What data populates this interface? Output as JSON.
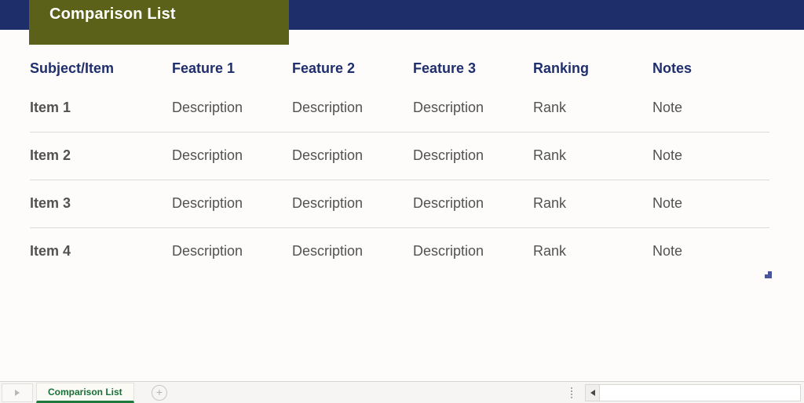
{
  "window": {
    "title": "Comparison List"
  },
  "table": {
    "headers": [
      "Subject/Item",
      "Feature 1",
      "Feature 2",
      "Feature 3",
      "Ranking",
      "Notes"
    ],
    "rows": [
      {
        "item": "Item 1",
        "feature1": "Description",
        "feature2": "Description",
        "feature3": "Description",
        "ranking": "Rank",
        "notes": "Note"
      },
      {
        "item": "Item 2",
        "feature1": "Description",
        "feature2": "Description",
        "feature3": "Description",
        "ranking": "Rank",
        "notes": "Note"
      },
      {
        "item": "Item 3",
        "feature1": "Description",
        "feature2": "Description",
        "feature3": "Description",
        "ranking": "Rank",
        "notes": "Note"
      },
      {
        "item": "Item 4",
        "feature1": "Description",
        "feature2": "Description",
        "feature3": "Description",
        "ranking": "Rank",
        "notes": "Note"
      }
    ]
  },
  "sheet_bar": {
    "prev_sheet_icon": "triangle-right-icon",
    "active_sheet": "Comparison List",
    "add_sheet_icon": "+",
    "split_handle_icon": "vertical-dots-icon",
    "scroll_left_icon": "triangle-left-icon"
  },
  "colors": {
    "banner_navy": "#1e2e6b",
    "title_olive": "#5b6118",
    "header_text": "#1f2f6e",
    "item_text": "#8a5a18",
    "body_text": "#545250",
    "page_background": "#fdfcfa",
    "row_rule": "#dedbd6",
    "sheet_tab_green": "#17703a",
    "resize_handle_blue": "#4a5699"
  }
}
